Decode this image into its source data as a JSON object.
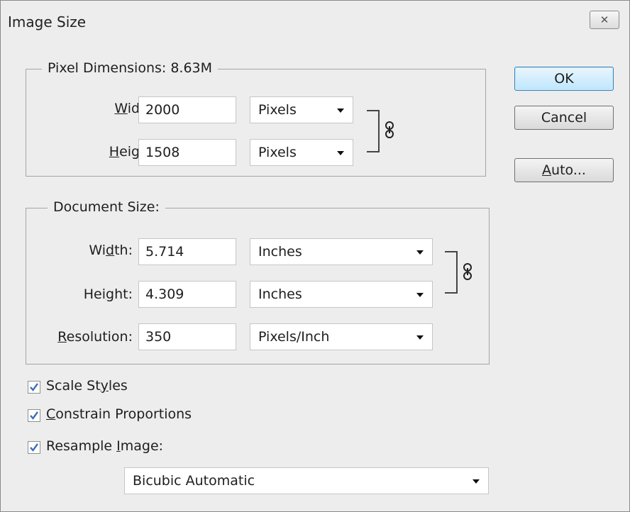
{
  "window": {
    "title": "Image Size",
    "close_glyph": "✕"
  },
  "pixel_dimensions": {
    "legend": "Pixel Dimensions:  8.63M",
    "width": {
      "label_mnemonic": "W",
      "label_rest": "idth:",
      "value": "2000",
      "unit": "Pixels"
    },
    "height": {
      "label_mnemonic": "H",
      "label_rest": "eight:",
      "value": "1508",
      "unit": "Pixels"
    }
  },
  "document_size": {
    "legend": "Document Size:",
    "width": {
      "label_pre": "Wi",
      "label_mnemonic": "d",
      "label_rest": "th:",
      "value": "5.714",
      "unit": "Inches"
    },
    "height": {
      "label_pre": "Hei",
      "label_mnemonic": "g",
      "label_rest": "ht:",
      "value": "4.309",
      "unit": "Inches"
    },
    "resolution": {
      "label_mnemonic": "R",
      "label_rest": "esolution:",
      "value": "350",
      "unit": "Pixels/Inch"
    }
  },
  "buttons": {
    "ok": "OK",
    "cancel": "Cancel",
    "auto_mnemonic": "A",
    "auto_rest": "uto..."
  },
  "options": {
    "scale_styles": {
      "pre": "Scale St",
      "mnemonic": "y",
      "rest": "les",
      "checked": true
    },
    "constrain": {
      "mnemonic": "C",
      "rest": "onstrain Proportions",
      "checked": true
    },
    "resample": {
      "pre": "Resample ",
      "mnemonic": "I",
      "rest": "mage:",
      "checked": true
    }
  },
  "resample_method": {
    "value": "Bicubic Automatic"
  },
  "icons": {
    "chain": "chain-link-icon",
    "checkmark": "checkmark-icon",
    "dropdown": "dropdown-arrow-icon"
  },
  "colors": {
    "check": "#3b6fb6",
    "ok_border": "#3c7fb1"
  }
}
